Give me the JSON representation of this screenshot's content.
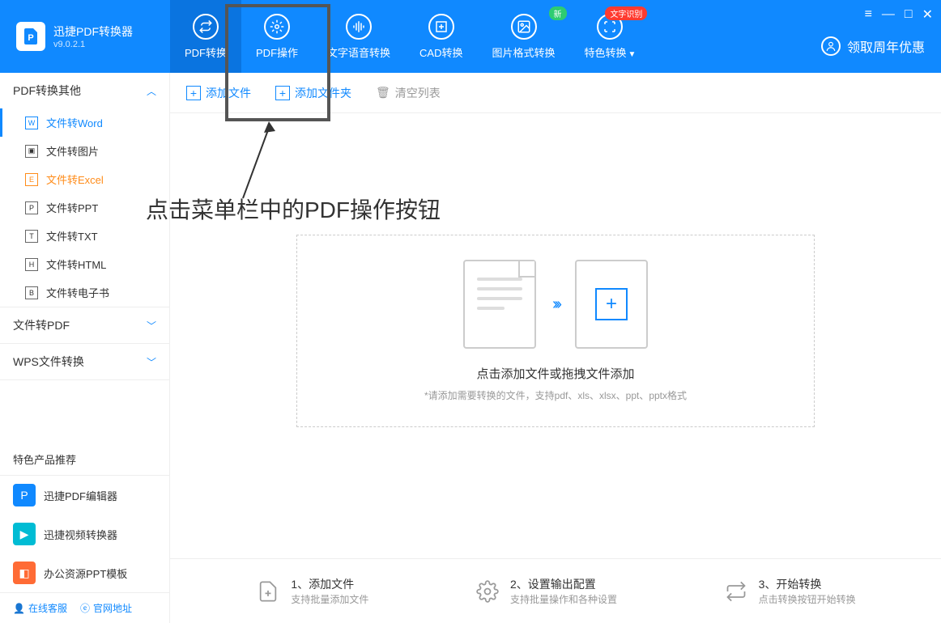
{
  "app": {
    "title": "迅捷PDF转换器",
    "version": "v9.0.2.1"
  },
  "nav": {
    "tabs": [
      {
        "label": "PDF转换"
      },
      {
        "label": "PDF操作"
      },
      {
        "label": "文字语音转换"
      },
      {
        "label": "CAD转换"
      },
      {
        "label": "图片格式转换",
        "badge": "新"
      },
      {
        "label": "特色转换",
        "badge": "文字识别"
      }
    ]
  },
  "promo_header": "领取周年优惠",
  "sidebar": {
    "groups": [
      {
        "title": "PDF转换其他",
        "expanded": true,
        "items": [
          {
            "label": "文件转Word",
            "icon": "W",
            "active": true
          },
          {
            "label": "文件转图片",
            "icon": "▣"
          },
          {
            "label": "文件转Excel",
            "icon": "E",
            "highlight": true
          },
          {
            "label": "文件转PPT",
            "icon": "P"
          },
          {
            "label": "文件转TXT",
            "icon": "T"
          },
          {
            "label": "文件转HTML",
            "icon": "H"
          },
          {
            "label": "文件转电子书",
            "icon": "B"
          }
        ]
      },
      {
        "title": "文件转PDF",
        "expanded": false
      },
      {
        "title": "WPS文件转换",
        "expanded": false
      }
    ],
    "promo_title": "特色产品推荐",
    "promos": [
      {
        "label": "迅捷PDF编辑器"
      },
      {
        "label": "迅捷视频转换器"
      },
      {
        "label": "办公资源PPT模板"
      }
    ],
    "footer": {
      "service": "在线客服",
      "website": "官网地址"
    }
  },
  "toolbar": {
    "add_file": "添加文件",
    "add_folder": "添加文件夹",
    "clear": "清空列表"
  },
  "dropzone": {
    "text1": "点击添加文件或拖拽文件添加",
    "text2": "*请添加需要转换的文件，支持pdf、xls、xlsx、ppt、pptx格式"
  },
  "steps": [
    {
      "title": "1、添加文件",
      "sub": "支持批量添加文件"
    },
    {
      "title": "2、设置输出配置",
      "sub": "支持批量操作和各种设置"
    },
    {
      "title": "3、开始转换",
      "sub": "点击转换按钮开始转换"
    }
  ],
  "annotation": "点击菜单栏中的PDF操作按钮"
}
